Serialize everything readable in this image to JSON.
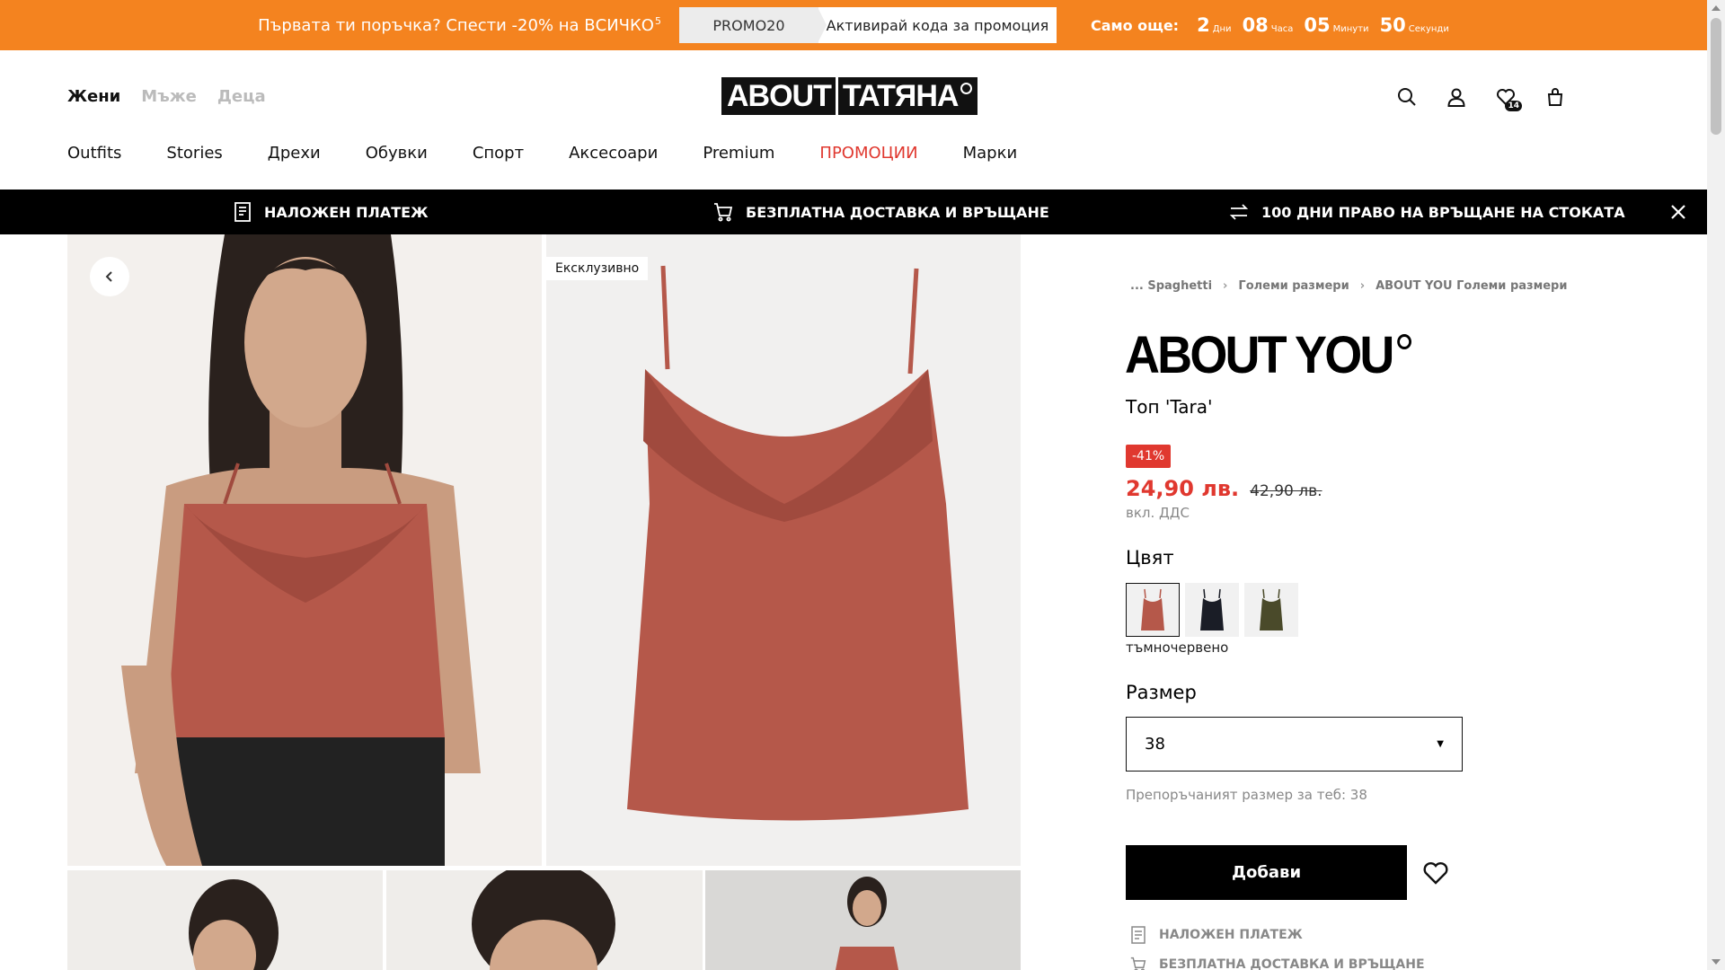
{
  "promo": {
    "text": "Първата ти поръчка? Спести -20% на ВСИЧКО",
    "footnote": "5",
    "code": "PROMO20",
    "activate_label": "Активирай кода за промоция",
    "remaining_label": "Само още:",
    "countdown": [
      {
        "value": "2",
        "unit": "Дни"
      },
      {
        "value": "08",
        "unit": "Часа"
      },
      {
        "value": "05",
        "unit": "Минути"
      },
      {
        "value": "50",
        "unit": "Секунди"
      }
    ]
  },
  "header": {
    "gender_tabs": [
      "Жени",
      "Мъже",
      "Деца"
    ],
    "logo_left": "ABOUT",
    "logo_right": "TATЯНА",
    "wishlist_count": "14"
  },
  "mainnav": [
    "Outfits",
    "Stories",
    "Дрехи",
    "Обувки",
    "Спорт",
    "Аксесоари",
    "Premium",
    "ПРОМОЦИИ",
    "Марки"
  ],
  "strip": {
    "cod": "НАЛОЖЕН ПЛАТЕЖ",
    "free_delivery": "БЕЗПЛАТНА ДОСТАВКА И ВРЪЩАНЕ",
    "return_days": "100 ДНИ ПРАВО НА ВРЪЩАНЕ НА СТОКАТА"
  },
  "gallery": {
    "exclusive_label": "Ексклузивно"
  },
  "product": {
    "breadcrumb": [
      "... Spaghetti",
      "Големи размери",
      "ABOUT YOU Големи размери"
    ],
    "brand": "ABOUT YOU",
    "name": "Топ 'Tara'",
    "discount": "-41%",
    "price_now": "24,90 лв.",
    "price_old": "42,90 лв.",
    "vat": "вкл. ДДС",
    "color_title": "Цвят",
    "color_name": "тъмночервено",
    "swatch_colors": [
      "#b5584a",
      "#1a1d26",
      "#4a4a2a"
    ],
    "size_title": "Размер",
    "size_value": "38",
    "size_recommendation": "Препоръчаният размер за теб: 38",
    "add_label": "Добави",
    "perks": [
      "НАЛОЖЕН ПЛАТЕЖ",
      "БЕЗПЛАТНА ДОСТАВКА И ВРЪЩАНЕ"
    ]
  },
  "colors": {
    "promo_bg": "#f4831f",
    "sale_red": "#e0382f",
    "top_color": "#b5584a"
  }
}
